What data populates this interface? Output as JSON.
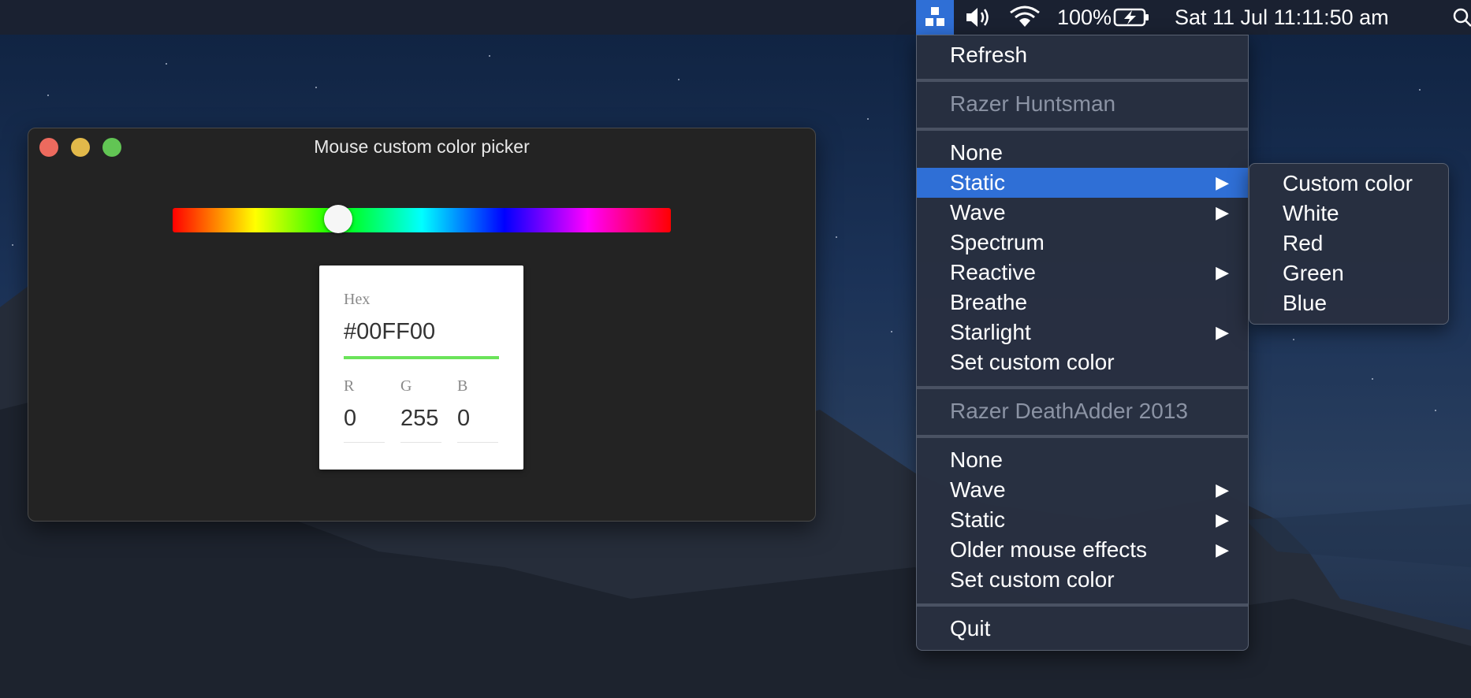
{
  "menubar": {
    "volume_icon": "speaker-icon",
    "wifi_icon": "wifi-icon",
    "battery_percent": "100%",
    "battery_icon": "battery-charging-icon",
    "datetime": "Sat 11 Jul  11:11:50 am",
    "search_icon": "search-icon",
    "app_icon": "razer-tray-icon"
  },
  "window": {
    "title": "Mouse custom color picker",
    "hue_fraction": 0.333,
    "picker": {
      "hex_label": "Hex",
      "hex_value": "#00FF00",
      "hex_underline_color": "#6be35a",
      "r_label": "R",
      "g_label": "G",
      "b_label": "B",
      "r_value": "0",
      "g_value": "255",
      "b_value": "0"
    }
  },
  "menu": {
    "refresh": "Refresh",
    "device1_header": "Razer Huntsman",
    "device1_items": [
      {
        "label": "None",
        "submenu": false
      },
      {
        "label": "Static",
        "submenu": true
      },
      {
        "label": "Wave",
        "submenu": true
      },
      {
        "label": "Spectrum",
        "submenu": false
      },
      {
        "label": "Reactive",
        "submenu": true
      },
      {
        "label": "Breathe",
        "submenu": false
      },
      {
        "label": "Starlight",
        "submenu": true
      },
      {
        "label": "Set custom color",
        "submenu": false
      }
    ],
    "device2_header": "Razer DeathAdder 2013",
    "device2_items": [
      {
        "label": "None",
        "submenu": false
      },
      {
        "label": "Wave",
        "submenu": true
      },
      {
        "label": "Static",
        "submenu": true
      },
      {
        "label": "Older mouse effects",
        "submenu": true
      },
      {
        "label": "Set custom color",
        "submenu": false
      }
    ],
    "quit": "Quit",
    "arrow_glyph": "▶"
  },
  "submenu": {
    "items": [
      "Custom color",
      "White",
      "Red",
      "Green",
      "Blue"
    ]
  },
  "colors": {
    "accent": "#2f6fd6",
    "close": "#ed6a5e",
    "minimize": "#e2b94a",
    "zoom": "#62c554"
  }
}
